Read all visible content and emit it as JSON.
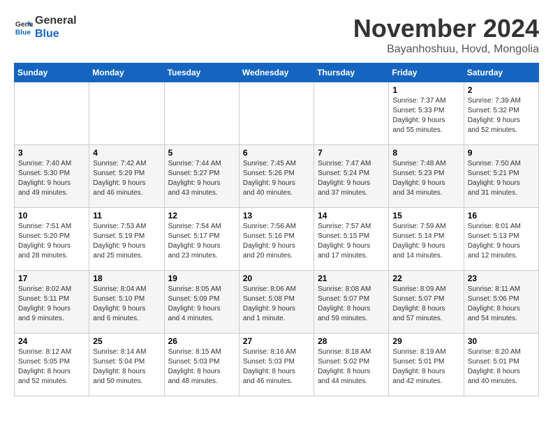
{
  "logo": {
    "line1": "General",
    "line2": "Blue"
  },
  "title": "November 2024",
  "location": "Bayanhoshuu, Hovd, Mongolia",
  "weekdays": [
    "Sunday",
    "Monday",
    "Tuesday",
    "Wednesday",
    "Thursday",
    "Friday",
    "Saturday"
  ],
  "weeks": [
    [
      {
        "day": "",
        "info": ""
      },
      {
        "day": "",
        "info": ""
      },
      {
        "day": "",
        "info": ""
      },
      {
        "day": "",
        "info": ""
      },
      {
        "day": "",
        "info": ""
      },
      {
        "day": "1",
        "info": "Sunrise: 7:37 AM\nSunset: 5:33 PM\nDaylight: 9 hours\nand 55 minutes."
      },
      {
        "day": "2",
        "info": "Sunrise: 7:39 AM\nSunset: 5:32 PM\nDaylight: 9 hours\nand 52 minutes."
      }
    ],
    [
      {
        "day": "3",
        "info": "Sunrise: 7:40 AM\nSunset: 5:30 PM\nDaylight: 9 hours\nand 49 minutes."
      },
      {
        "day": "4",
        "info": "Sunrise: 7:42 AM\nSunset: 5:29 PM\nDaylight: 9 hours\nand 46 minutes."
      },
      {
        "day": "5",
        "info": "Sunrise: 7:44 AM\nSunset: 5:27 PM\nDaylight: 9 hours\nand 43 minutes."
      },
      {
        "day": "6",
        "info": "Sunrise: 7:45 AM\nSunset: 5:26 PM\nDaylight: 9 hours\nand 40 minutes."
      },
      {
        "day": "7",
        "info": "Sunrise: 7:47 AM\nSunset: 5:24 PM\nDaylight: 9 hours\nand 37 minutes."
      },
      {
        "day": "8",
        "info": "Sunrise: 7:48 AM\nSunset: 5:23 PM\nDaylight: 9 hours\nand 34 minutes."
      },
      {
        "day": "9",
        "info": "Sunrise: 7:50 AM\nSunset: 5:21 PM\nDaylight: 9 hours\nand 31 minutes."
      }
    ],
    [
      {
        "day": "10",
        "info": "Sunrise: 7:51 AM\nSunset: 5:20 PM\nDaylight: 9 hours\nand 28 minutes."
      },
      {
        "day": "11",
        "info": "Sunrise: 7:53 AM\nSunset: 5:19 PM\nDaylight: 9 hours\nand 25 minutes."
      },
      {
        "day": "12",
        "info": "Sunrise: 7:54 AM\nSunset: 5:17 PM\nDaylight: 9 hours\nand 23 minutes."
      },
      {
        "day": "13",
        "info": "Sunrise: 7:56 AM\nSunset: 5:16 PM\nDaylight: 9 hours\nand 20 minutes."
      },
      {
        "day": "14",
        "info": "Sunrise: 7:57 AM\nSunset: 5:15 PM\nDaylight: 9 hours\nand 17 minutes."
      },
      {
        "day": "15",
        "info": "Sunrise: 7:59 AM\nSunset: 5:14 PM\nDaylight: 9 hours\nand 14 minutes."
      },
      {
        "day": "16",
        "info": "Sunrise: 8:01 AM\nSunset: 5:13 PM\nDaylight: 9 hours\nand 12 minutes."
      }
    ],
    [
      {
        "day": "17",
        "info": "Sunrise: 8:02 AM\nSunset: 5:11 PM\nDaylight: 9 hours\nand 9 minutes."
      },
      {
        "day": "18",
        "info": "Sunrise: 8:04 AM\nSunset: 5:10 PM\nDaylight: 9 hours\nand 6 minutes."
      },
      {
        "day": "19",
        "info": "Sunrise: 8:05 AM\nSunset: 5:09 PM\nDaylight: 9 hours\nand 4 minutes."
      },
      {
        "day": "20",
        "info": "Sunrise: 8:06 AM\nSunset: 5:08 PM\nDaylight: 9 hours\nand 1 minute."
      },
      {
        "day": "21",
        "info": "Sunrise: 8:08 AM\nSunset: 5:07 PM\nDaylight: 8 hours\nand 59 minutes."
      },
      {
        "day": "22",
        "info": "Sunrise: 8:09 AM\nSunset: 5:07 PM\nDaylight: 8 hours\nand 57 minutes."
      },
      {
        "day": "23",
        "info": "Sunrise: 8:11 AM\nSunset: 5:06 PM\nDaylight: 8 hours\nand 54 minutes."
      }
    ],
    [
      {
        "day": "24",
        "info": "Sunrise: 8:12 AM\nSunset: 5:05 PM\nDaylight: 8 hours\nand 52 minutes."
      },
      {
        "day": "25",
        "info": "Sunrise: 8:14 AM\nSunset: 5:04 PM\nDaylight: 8 hours\nand 50 minutes."
      },
      {
        "day": "26",
        "info": "Sunrise: 8:15 AM\nSunset: 5:03 PM\nDaylight: 8 hours\nand 48 minutes."
      },
      {
        "day": "27",
        "info": "Sunrise: 8:16 AM\nSunset: 5:03 PM\nDaylight: 8 hours\nand 46 minutes."
      },
      {
        "day": "28",
        "info": "Sunrise: 8:18 AM\nSunset: 5:02 PM\nDaylight: 8 hours\nand 44 minutes."
      },
      {
        "day": "29",
        "info": "Sunrise: 8:19 AM\nSunset: 5:01 PM\nDaylight: 8 hours\nand 42 minutes."
      },
      {
        "day": "30",
        "info": "Sunrise: 8:20 AM\nSunset: 5:01 PM\nDaylight: 8 hours\nand 40 minutes."
      }
    ]
  ]
}
